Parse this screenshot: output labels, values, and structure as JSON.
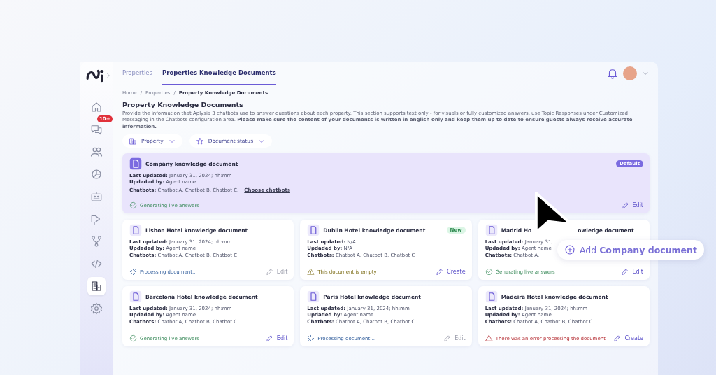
{
  "header": {
    "tabs": [
      {
        "label": "Properties",
        "selected": false
      },
      {
        "label": "Properties Knowledge Documents",
        "selected": true
      }
    ]
  },
  "sidebar": {
    "notification_badge": "10+",
    "items": [
      {
        "selected": false
      },
      {
        "selected": false
      },
      {
        "selected": false
      },
      {
        "selected": false
      },
      {
        "selected": false
      },
      {
        "selected": false
      },
      {
        "selected": false
      },
      {
        "selected": false
      },
      {
        "selected": true
      },
      {
        "selected": false
      }
    ]
  },
  "breadcrumb": [
    {
      "label": "Home",
      "separator": "/"
    },
    {
      "label": "Properties",
      "separator": "/"
    },
    {
      "label": "Property Knowledge Documents"
    }
  ],
  "page_title": "Property Knowledge Documents",
  "description": "Provide the information that Aplysia 3 chatbots use to answer questions about each property. This section supports text only - for visuals or fully customized answers, use Topic Responses under Customized Messaging in the Chatbots configuration area. **Please make sure the content of your documents is written in english only and keep them up to date to ensure guests always receive accurate information.**",
  "filters": [
    {
      "label": "Property"
    },
    {
      "label": "Document status"
    }
  ],
  "company_document": {
    "title": "Company knowledge document",
    "badge": "Default",
    "last_updated_label": "Last updated:",
    "last_updated": "January 31, 2024; hh:mm",
    "updated_by_label": "Updaded by:",
    "updated_by": "Agent name",
    "chatbots_label": "Chatbots:",
    "chatbots": "Chatbot A, Chatbot B, Chatbot C.",
    "choose_link": "Choose chatbots",
    "status": {
      "kind": "live",
      "text": "Generating live answers"
    },
    "action": {
      "label": "Edit",
      "disabled": false
    }
  },
  "documents": [
    {
      "title": "Lisbon Hotel knowledge document",
      "last_updated_label": "Last updated:",
      "last_updated": "January 31, 2024; hh:mm",
      "updated_by_label": "Updaded by:",
      "updated_by": "Agent name",
      "chatbots_label": "Chatbots:",
      "chatbots": "Chatbot A, Chatbot B, Chatbot C",
      "status": {
        "kind": "processing",
        "text": "Processing document..."
      },
      "action": {
        "label": "Edit",
        "disabled": true
      }
    },
    {
      "title": "Dublin Hotel knowledge document",
      "badge": "New",
      "last_updated_label": "Last updated:",
      "last_updated": "N/A",
      "updated_by_label": "Updaded by:",
      "updated_by": "N/A",
      "chatbots_label": "Chatbots:",
      "chatbots": "Chatbot A, Chatbot B, Chatbot C",
      "status": {
        "kind": "empty",
        "text": "This document is empty"
      },
      "action": {
        "label": "Create",
        "disabled": false
      }
    },
    {
      "title": "Madrid Ho",
      "title_tail": "owledge document",
      "last_updated_label": "Last updated:",
      "last_updated": "January 31,",
      "updated_by_label": "Updaded by:",
      "updated_by": "Agent name",
      "chatbots_label": "Chatbots:",
      "chatbots": "Chatbot A,",
      "status": {
        "kind": "live",
        "text": "Generating live answers"
      },
      "action": {
        "label": "Edit",
        "disabled": false
      }
    },
    {
      "title": "Barcelona Hotel knowledge document",
      "last_updated_label": "Last updated:",
      "last_updated": "January 31, 2024; hh:mm",
      "updated_by_label": "Updaded by:",
      "updated_by": "Agent name",
      "chatbots_label": "Chatbots:",
      "chatbots": "Chatbot A, Chatbot B, Chatbot C",
      "status": {
        "kind": "live",
        "text": "Generating live answers"
      },
      "action": {
        "label": "Edit",
        "disabled": false
      }
    },
    {
      "title": "Paris Hotel knowledge document",
      "last_updated_label": "Last updated:",
      "last_updated": "January 31, 2024; hh:mm",
      "updated_by_label": "Updaded by:",
      "updated_by": "Agent name",
      "chatbots_label": "Chatbots:",
      "chatbots": "Chatbot A, Chatbot B, Chatbot C",
      "status": {
        "kind": "processing",
        "text": "Processing document..."
      },
      "action": {
        "label": "Edit",
        "disabled": true
      }
    },
    {
      "title": "Madeira Hotel knowledge document",
      "last_updated_label": "Last updated:",
      "last_updated": "January 31, 2024; hh:mm",
      "updated_by_label": "Updaded by:",
      "updated_by": "Agent name",
      "chatbots_label": "Chatbots:",
      "chatbots": "Chatbot A, Chatbot B, Chatbot C",
      "status": {
        "kind": "error",
        "text": "There was an error processing the document"
      },
      "action": {
        "label": "Create",
        "disabled": false
      }
    }
  ],
  "callout": {
    "text": "Add **Company document**"
  }
}
